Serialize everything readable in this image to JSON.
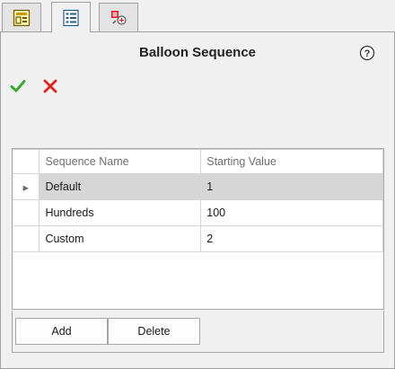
{
  "tabs": [
    {
      "icon": "property-manager-icon",
      "active": false
    },
    {
      "icon": "configuration-list-icon",
      "active": true
    },
    {
      "icon": "appearance-manager-icon",
      "active": false
    }
  ],
  "panel": {
    "title": "Balloon Sequence",
    "help_icon": "help-icon",
    "ok_icon": "checkmark-icon",
    "cancel_icon": "x-icon"
  },
  "grid": {
    "columns": [
      "Sequence Name",
      "Starting Value"
    ],
    "selected_row_marker": "▸",
    "rows": [
      {
        "name": "Default",
        "value": "1",
        "selected": true
      },
      {
        "name": "Hundreds",
        "value": "100",
        "selected": false
      },
      {
        "name": "Custom",
        "value": "2",
        "selected": false
      }
    ]
  },
  "buttons": {
    "add_label": "Add",
    "delete_label": "Delete"
  },
  "colors": {
    "accept": "#3aaa35",
    "cancel": "#e0261b",
    "selected_row": "#d6d6d6"
  }
}
